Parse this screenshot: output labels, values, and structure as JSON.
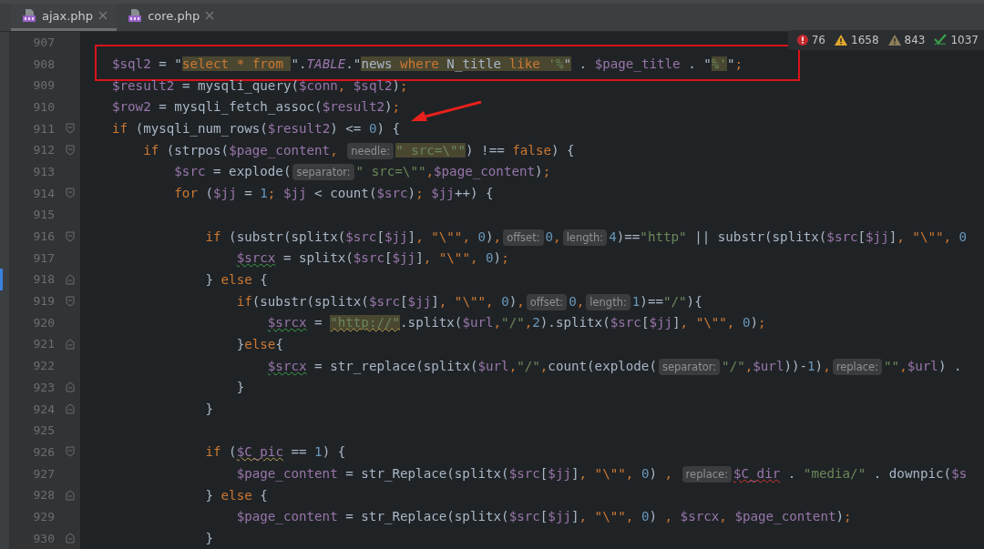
{
  "tabs": [
    {
      "label": "ajax.php",
      "selected": true
    },
    {
      "label": "core.php",
      "selected": false
    }
  ],
  "inspections": [
    {
      "kind": "error",
      "count": "76"
    },
    {
      "kind": "warning",
      "count": "1658"
    },
    {
      "kind": "weak",
      "count": "843"
    },
    {
      "kind": "typo",
      "count": "1037"
    }
  ],
  "lines": [
    {
      "number": "907",
      "fold_open": false,
      "fold_close": false,
      "changed": false,
      "boxed": false,
      "pointed": false
    },
    {
      "number": "908",
      "fold_open": false,
      "fold_close": false,
      "changed": false,
      "boxed": true,
      "pointed": false,
      "tokens": [
        {
          "kind": "var",
          "text": "$sql2"
        },
        {
          "kind": "txt",
          "text": " = \""
        },
        {
          "kind": "kwm",
          "text": "select * from "
        },
        {
          "kind": "txt",
          "text": "\"."
        },
        {
          "kind": "const",
          "text": "TABLE"
        },
        {
          "kind": "txt",
          "text": ".\""
        },
        {
          "kind": "txtm",
          "text": "news "
        },
        {
          "kind": "kwm",
          "text": "where"
        },
        {
          "kind": "txtm",
          "text": " N_title "
        },
        {
          "kind": "kwm",
          "text": "like "
        },
        {
          "kind": "strm",
          "text": "'%"
        },
        {
          "kind": "txtm",
          "text": "\""
        },
        {
          "kind": "txt",
          "text": " . "
        },
        {
          "kind": "var",
          "text": "$page_title"
        },
        {
          "kind": "txt",
          "text": " . \""
        },
        {
          "kind": "strm",
          "text": "%'"
        },
        {
          "kind": "txt",
          "text": "\""
        },
        {
          "kind": "op",
          "text": ";"
        }
      ]
    },
    {
      "number": "909",
      "fold_open": false,
      "fold_close": false,
      "changed": false,
      "boxed": false,
      "pointed": false,
      "tokens": [
        {
          "kind": "var",
          "text": "$result2"
        },
        {
          "kind": "txt",
          "text": " = mysqli_query("
        },
        {
          "kind": "var",
          "text": "$conn"
        },
        {
          "kind": "op",
          "text": ", "
        },
        {
          "kind": "var",
          "text": "$sql2"
        },
        {
          "kind": "txt",
          "text": ")"
        },
        {
          "kind": "op",
          "text": ";"
        }
      ]
    },
    {
      "number": "910",
      "fold_open": false,
      "fold_close": false,
      "changed": false,
      "boxed": false,
      "pointed": false,
      "tokens": [
        {
          "kind": "var",
          "text": "$row2"
        },
        {
          "kind": "txt",
          "text": " = mysqli_fetch_assoc("
        },
        {
          "kind": "var",
          "text": "$result2"
        },
        {
          "kind": "txt",
          "text": ")"
        },
        {
          "kind": "op",
          "text": ";"
        }
      ]
    },
    {
      "number": "911",
      "fold_open": true,
      "fold_close": false,
      "changed": false,
      "boxed": false,
      "pointed": true,
      "tokens": [
        {
          "kind": "kw",
          "text": "if"
        },
        {
          "kind": "txt",
          "text": " (mysqli_num_rows("
        },
        {
          "kind": "var",
          "text": "$result2"
        },
        {
          "kind": "txt",
          "text": ") <= "
        },
        {
          "kind": "num",
          "text": "0"
        },
        {
          "kind": "txt",
          "text": ") {"
        }
      ],
      "children": [
        {
          "number": "912",
          "fold_open": true,
          "fold_close": false,
          "changed": false,
          "boxed": false,
          "pointed": false,
          "tokens": [
            {
              "kind": "kw",
              "text": "if"
            },
            {
              "kind": "txt",
              "text": " (strpos("
            },
            {
              "kind": "var",
              "text": "$page_content"
            },
            {
              "kind": "op",
              "text": ", "
            },
            {
              "kind": "hint",
              "text": "needle:"
            },
            {
              "kind": "strm",
              "text": "\" src=\\\"\""
            },
            {
              "kind": "txt",
              "text": ") !== "
            },
            {
              "kind": "kw",
              "text": "false"
            },
            {
              "kind": "txt",
              "text": ") {"
            }
          ],
          "children": [
            {
              "number": "913",
              "fold_open": false,
              "fold_close": false,
              "changed": false,
              "boxed": false,
              "pointed": false,
              "tokens": [
                {
                  "kind": "var",
                  "text": "$src"
                },
                {
                  "kind": "txt",
                  "text": " = explode("
                },
                {
                  "kind": "hint",
                  "text": "separator:"
                },
                {
                  "kind": "str",
                  "text": "\" src=\\\"\""
                },
                {
                  "kind": "op",
                  "text": ","
                },
                {
                  "kind": "var",
                  "text": "$page_content"
                },
                {
                  "kind": "txt",
                  "text": ")"
                },
                {
                  "kind": "op",
                  "text": ";"
                }
              ]
            },
            {
              "number": "914",
              "fold_open": true,
              "fold_close": false,
              "changed": false,
              "boxed": false,
              "pointed": false,
              "tokens": [
                {
                  "kind": "kw",
                  "text": "for"
                },
                {
                  "kind": "txt",
                  "text": " ("
                },
                {
                  "kind": "var",
                  "text": "$jj"
                },
                {
                  "kind": "txt",
                  "text": " = "
                },
                {
                  "kind": "num",
                  "text": "1"
                },
                {
                  "kind": "op",
                  "text": "; "
                },
                {
                  "kind": "var",
                  "text": "$jj"
                },
                {
                  "kind": "txt",
                  "text": " < count("
                },
                {
                  "kind": "var",
                  "text": "$src"
                },
                {
                  "kind": "txt",
                  "text": ")"
                },
                {
                  "kind": "op",
                  "text": "; "
                },
                {
                  "kind": "var",
                  "text": "$jj"
                },
                {
                  "kind": "txt",
                  "text": "++) {"
                }
              ],
              "children": [
                {
                  "number": "915",
                  "fold_open": false,
                  "fold_close": false,
                  "changed": false,
                  "boxed": false,
                  "pointed": false
                },
                {
                  "number": "916",
                  "fold_open": true,
                  "fold_close": false,
                  "changed": false,
                  "boxed": false,
                  "pointed": false,
                  "tokens": [
                    {
                      "kind": "kw",
                      "text": "if"
                    },
                    {
                      "kind": "txt",
                      "text": " (substr(splitx("
                    },
                    {
                      "kind": "var",
                      "text": "$src"
                    },
                    {
                      "kind": "txt",
                      "text": "["
                    },
                    {
                      "kind": "var",
                      "text": "$jj"
                    },
                    {
                      "kind": "txt",
                      "text": "]"
                    },
                    {
                      "kind": "op",
                      "text": ", "
                    },
                    {
                      "kind": "esc",
                      "text": "\"\\\"\""
                    },
                    {
                      "kind": "op",
                      "text": ", "
                    },
                    {
                      "kind": "num",
                      "text": "0"
                    },
                    {
                      "kind": "txt",
                      "text": ")"
                    },
                    {
                      "kind": "op",
                      "text": ","
                    },
                    {
                      "kind": "hint",
                      "text": "offset:"
                    },
                    {
                      "kind": "num",
                      "text": "0"
                    },
                    {
                      "kind": "op",
                      "text": ","
                    },
                    {
                      "kind": "hint",
                      "text": "length:"
                    },
                    {
                      "kind": "num",
                      "text": "4"
                    },
                    {
                      "kind": "txt",
                      "text": ")=="
                    },
                    {
                      "kind": "str",
                      "text": "\"http\""
                    },
                    {
                      "kind": "txt",
                      "text": " || substr(splitx("
                    },
                    {
                      "kind": "var",
                      "text": "$src"
                    },
                    {
                      "kind": "txt",
                      "text": "["
                    },
                    {
                      "kind": "var",
                      "text": "$jj"
                    },
                    {
                      "kind": "txt",
                      "text": "]"
                    },
                    {
                      "kind": "op",
                      "text": ", "
                    },
                    {
                      "kind": "esc",
                      "text": "\"\\\"\""
                    },
                    {
                      "kind": "op",
                      "text": ", "
                    },
                    {
                      "kind": "num",
                      "text": "0"
                    }
                  ],
                  "children": [
                    {
                      "number": "917",
                      "fold_open": false,
                      "fold_close": false,
                      "changed": false,
                      "boxed": false,
                      "pointed": false,
                      "tokens": [
                        {
                          "kind": "vartypo",
                          "text": "$srcx"
                        },
                        {
                          "kind": "txt",
                          "text": " = splitx("
                        },
                        {
                          "kind": "var",
                          "text": "$src"
                        },
                        {
                          "kind": "txt",
                          "text": "["
                        },
                        {
                          "kind": "var",
                          "text": "$jj"
                        },
                        {
                          "kind": "txt",
                          "text": "]"
                        },
                        {
                          "kind": "op",
                          "text": ", "
                        },
                        {
                          "kind": "esc",
                          "text": "\"\\\"\""
                        },
                        {
                          "kind": "op",
                          "text": ", "
                        },
                        {
                          "kind": "num",
                          "text": "0"
                        },
                        {
                          "kind": "txt",
                          "text": ")"
                        },
                        {
                          "kind": "op",
                          "text": ";"
                        }
                      ]
                    }
                  ]
                },
                {
                  "number": "918",
                  "fold_open": false,
                  "fold_close": true,
                  "changed": true,
                  "boxed": false,
                  "pointed": false,
                  "tokens": [
                    {
                      "kind": "txt",
                      "text": "} "
                    },
                    {
                      "kind": "kw",
                      "text": "else"
                    },
                    {
                      "kind": "txt",
                      "text": " {"
                    }
                  ],
                  "children": [
                    {
                      "number": "919",
                      "fold_open": true,
                      "fold_close": false,
                      "changed": false,
                      "boxed": false,
                      "pointed": false,
                      "tokens": [
                        {
                          "kind": "kw",
                          "text": "if"
                        },
                        {
                          "kind": "txt",
                          "text": "(substr(splitx("
                        },
                        {
                          "kind": "var",
                          "text": "$src"
                        },
                        {
                          "kind": "txt",
                          "text": "["
                        },
                        {
                          "kind": "var",
                          "text": "$jj"
                        },
                        {
                          "kind": "txt",
                          "text": "]"
                        },
                        {
                          "kind": "op",
                          "text": ", "
                        },
                        {
                          "kind": "esc",
                          "text": "\"\\\"\""
                        },
                        {
                          "kind": "op",
                          "text": ", "
                        },
                        {
                          "kind": "num",
                          "text": "0"
                        },
                        {
                          "kind": "txt",
                          "text": ")"
                        },
                        {
                          "kind": "op",
                          "text": ","
                        },
                        {
                          "kind": "hint",
                          "text": "offset:"
                        },
                        {
                          "kind": "num",
                          "text": "0"
                        },
                        {
                          "kind": "op",
                          "text": ","
                        },
                        {
                          "kind": "hint",
                          "text": "length:"
                        },
                        {
                          "kind": "num",
                          "text": "1"
                        },
                        {
                          "kind": "txt",
                          "text": ")=="
                        },
                        {
                          "kind": "str",
                          "text": "\"/\""
                        },
                        {
                          "kind": "txt",
                          "text": "){"
                        }
                      ],
                      "children": [
                        {
                          "number": "920",
                          "fold_open": false,
                          "fold_close": false,
                          "changed": false,
                          "boxed": false,
                          "pointed": false,
                          "tokens": [
                            {
                              "kind": "vartypo",
                              "text": "$srcx"
                            },
                            {
                              "kind": "txt",
                              "text": " = "
                            },
                            {
                              "kind": "strmwarn",
                              "text": "\"http://\""
                            },
                            {
                              "kind": "txt",
                              "text": ".splitx("
                            },
                            {
                              "kind": "var",
                              "text": "$url"
                            },
                            {
                              "kind": "op",
                              "text": ","
                            },
                            {
                              "kind": "str",
                              "text": "\"/\""
                            },
                            {
                              "kind": "op",
                              "text": ","
                            },
                            {
                              "kind": "num",
                              "text": "2"
                            },
                            {
                              "kind": "txt",
                              "text": ").splitx("
                            },
                            {
                              "kind": "var",
                              "text": "$src"
                            },
                            {
                              "kind": "txt",
                              "text": "["
                            },
                            {
                              "kind": "var",
                              "text": "$jj"
                            },
                            {
                              "kind": "txt",
                              "text": "]"
                            },
                            {
                              "kind": "op",
                              "text": ", "
                            },
                            {
                              "kind": "esc",
                              "text": "\"\\\"\""
                            },
                            {
                              "kind": "op",
                              "text": ", "
                            },
                            {
                              "kind": "num",
                              "text": "0"
                            },
                            {
                              "kind": "txt",
                              "text": ")"
                            },
                            {
                              "kind": "op",
                              "text": ";"
                            }
                          ]
                        }
                      ]
                    },
                    {
                      "number": "921",
                      "fold_open": false,
                      "fold_close": true,
                      "changed": false,
                      "boxed": false,
                      "pointed": false,
                      "tokens": [
                        {
                          "kind": "txt",
                          "text": "}"
                        },
                        {
                          "kind": "kw",
                          "text": "else"
                        },
                        {
                          "kind": "txt",
                          "text": "{"
                        }
                      ],
                      "children": [
                        {
                          "number": "922",
                          "fold_open": false,
                          "fold_close": false,
                          "changed": false,
                          "boxed": false,
                          "pointed": false,
                          "tokens": [
                            {
                              "kind": "vartypo",
                              "text": "$srcx"
                            },
                            {
                              "kind": "txt",
                              "text": " = str_replace(splitx("
                            },
                            {
                              "kind": "var",
                              "text": "$url"
                            },
                            {
                              "kind": "op",
                              "text": ","
                            },
                            {
                              "kind": "str",
                              "text": "\"/\""
                            },
                            {
                              "kind": "op",
                              "text": ","
                            },
                            {
                              "kind": "txt",
                              "text": "count(explode("
                            },
                            {
                              "kind": "hint",
                              "text": "separator:"
                            },
                            {
                              "kind": "str",
                              "text": "\"/\""
                            },
                            {
                              "kind": "op",
                              "text": ","
                            },
                            {
                              "kind": "var",
                              "text": "$url"
                            },
                            {
                              "kind": "txt",
                              "text": "))-"
                            },
                            {
                              "kind": "num",
                              "text": "1"
                            },
                            {
                              "kind": "txt",
                              "text": ")"
                            },
                            {
                              "kind": "op",
                              "text": ","
                            },
                            {
                              "kind": "hint",
                              "text": "replace:"
                            },
                            {
                              "kind": "str",
                              "text": "\"\""
                            },
                            {
                              "kind": "op",
                              "text": ","
                            },
                            {
                              "kind": "var",
                              "text": "$url"
                            },
                            {
                              "kind": "txt",
                              "text": ") ."
                            }
                          ]
                        }
                      ]
                    },
                    {
                      "number": "923",
                      "fold_open": false,
                      "fold_close": true,
                      "changed": false,
                      "boxed": false,
                      "pointed": false,
                      "tokens": [
                        {
                          "kind": "txt",
                          "text": "}"
                        }
                      ]
                    }
                  ]
                },
                {
                  "number": "924",
                  "fold_open": false,
                  "fold_close": true,
                  "changed": false,
                  "boxed": false,
                  "pointed": false,
                  "tokens": [
                    {
                      "kind": "txt",
                      "text": "}"
                    }
                  ]
                },
                {
                  "number": "925",
                  "fold_open": false,
                  "fold_close": false,
                  "changed": false,
                  "boxed": false,
                  "pointed": false
                },
                {
                  "number": "926",
                  "fold_open": true,
                  "fold_close": false,
                  "changed": false,
                  "boxed": false,
                  "pointed": false,
                  "tokens": [
                    {
                      "kind": "kw",
                      "text": "if"
                    },
                    {
                      "kind": "txt",
                      "text": " ("
                    },
                    {
                      "kind": "varwarn",
                      "text": "$C_pic"
                    },
                    {
                      "kind": "txt",
                      "text": " == "
                    },
                    {
                      "kind": "num",
                      "text": "1"
                    },
                    {
                      "kind": "txt",
                      "text": ") {"
                    }
                  ],
                  "children": [
                    {
                      "number": "927",
                      "fold_open": false,
                      "fold_close": false,
                      "changed": false,
                      "boxed": false,
                      "pointed": false,
                      "tokens": [
                        {
                          "kind": "var",
                          "text": "$page_content"
                        },
                        {
                          "kind": "txt",
                          "text": " = str_Replace(splitx("
                        },
                        {
                          "kind": "var",
                          "text": "$src"
                        },
                        {
                          "kind": "txt",
                          "text": "["
                        },
                        {
                          "kind": "var",
                          "text": "$jj"
                        },
                        {
                          "kind": "txt",
                          "text": "]"
                        },
                        {
                          "kind": "op",
                          "text": ", "
                        },
                        {
                          "kind": "esc",
                          "text": "\"\\\"\""
                        },
                        {
                          "kind": "op",
                          "text": ", "
                        },
                        {
                          "kind": "num",
                          "text": "0"
                        },
                        {
                          "kind": "txt",
                          "text": ") "
                        },
                        {
                          "kind": "op",
                          "text": ", "
                        },
                        {
                          "kind": "hint",
                          "text": "replace:"
                        },
                        {
                          "kind": "varerr",
                          "text": "$C_dir"
                        },
                        {
                          "kind": "txt",
                          "text": " . "
                        },
                        {
                          "kind": "str",
                          "text": "\"media/\""
                        },
                        {
                          "kind": "txt",
                          "text": " . downpic("
                        },
                        {
                          "kind": "var",
                          "text": "$s"
                        }
                      ]
                    }
                  ]
                },
                {
                  "number": "928",
                  "fold_open": false,
                  "fold_close": true,
                  "changed": false,
                  "boxed": false,
                  "pointed": false,
                  "tokens": [
                    {
                      "kind": "txt",
                      "text": "} "
                    },
                    {
                      "kind": "kw",
                      "text": "else"
                    },
                    {
                      "kind": "txt",
                      "text": " {"
                    }
                  ],
                  "children": [
                    {
                      "number": "929",
                      "fold_open": false,
                      "fold_close": false,
                      "changed": false,
                      "boxed": false,
                      "pointed": false,
                      "tokens": [
                        {
                          "kind": "var",
                          "text": "$page_content"
                        },
                        {
                          "kind": "txt",
                          "text": " = str_Replace(splitx("
                        },
                        {
                          "kind": "var",
                          "text": "$src"
                        },
                        {
                          "kind": "txt",
                          "text": "["
                        },
                        {
                          "kind": "var",
                          "text": "$jj"
                        },
                        {
                          "kind": "txt",
                          "text": "]"
                        },
                        {
                          "kind": "op",
                          "text": ", "
                        },
                        {
                          "kind": "esc",
                          "text": "\"\\\"\""
                        },
                        {
                          "kind": "op",
                          "text": ", "
                        },
                        {
                          "kind": "num",
                          "text": "0"
                        },
                        {
                          "kind": "txt",
                          "text": ") "
                        },
                        {
                          "kind": "op",
                          "text": ", "
                        },
                        {
                          "kind": "var",
                          "text": "$srcx"
                        },
                        {
                          "kind": "op",
                          "text": ", "
                        },
                        {
                          "kind": "var",
                          "text": "$page_content"
                        },
                        {
                          "kind": "txt",
                          "text": ")"
                        },
                        {
                          "kind": "op",
                          "text": ";"
                        }
                      ]
                    }
                  ]
                },
                {
                  "number": "930",
                  "fold_open": false,
                  "fold_close": true,
                  "changed": false,
                  "boxed": false,
                  "pointed": false,
                  "tokens": [
                    {
                      "kind": "txt",
                      "text": "}"
                    }
                  ]
                }
              ]
            }
          ]
        }
      ]
    }
  ]
}
